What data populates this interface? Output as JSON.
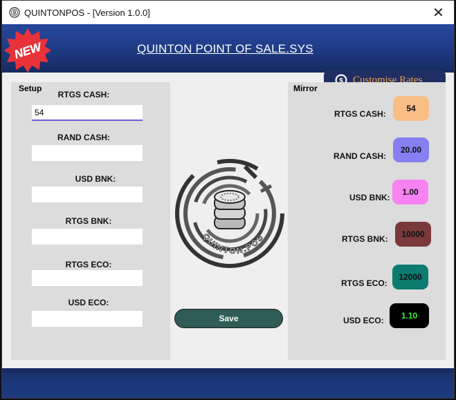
{
  "window": {
    "title": "QUINTONPOS - [Version 1.0.0]",
    "close_glyph": "✕"
  },
  "header": {
    "title": "QUINTON POINT OF SALE.SYS",
    "badge": "NEW",
    "badge_color": "#e8323a"
  },
  "customise": {
    "label": "Customise Rates",
    "icon": "dollar-coin-icon",
    "label_color": "#f0a14a",
    "bg": "#1f2f63"
  },
  "setup": {
    "title": "Setup",
    "fields": [
      {
        "label": "RTGS CASH:",
        "value": "54"
      },
      {
        "label": "RAND CASH:",
        "value": ""
      },
      {
        "label": "USD BNK:",
        "value": ""
      },
      {
        "label": "RTGS BNK:",
        "value": ""
      },
      {
        "label": "RTGS ECO:",
        "value": ""
      },
      {
        "label": "USD ECO:",
        "value": ""
      }
    ]
  },
  "mirror": {
    "title": "Mirror",
    "rows": [
      {
        "label": "RTGS CASH:",
        "value": "54",
        "bg": "#f9bd86",
        "fg": "#111111"
      },
      {
        "label": "RAND CASH:",
        "value": "20.00",
        "bg": "#8780f2",
        "fg": "#111111"
      },
      {
        "label": "USD BNK:",
        "value": "1.00",
        "bg": "#f783f2",
        "fg": "#111111"
      },
      {
        "label": "RTGS BNK:",
        "value": "10000",
        "bg": "#7a3a3c",
        "fg": "#111111"
      },
      {
        "label": "RTGS ECO:",
        "value": "12000",
        "bg": "#0c7b70",
        "fg": "#111111"
      },
      {
        "label": "USD ECO:",
        "value": "1.10",
        "bg": "#000000",
        "fg": "#3df03d"
      }
    ]
  },
  "logo": {
    "text": "QUINTON.POS"
  },
  "save": {
    "label": "Save"
  }
}
